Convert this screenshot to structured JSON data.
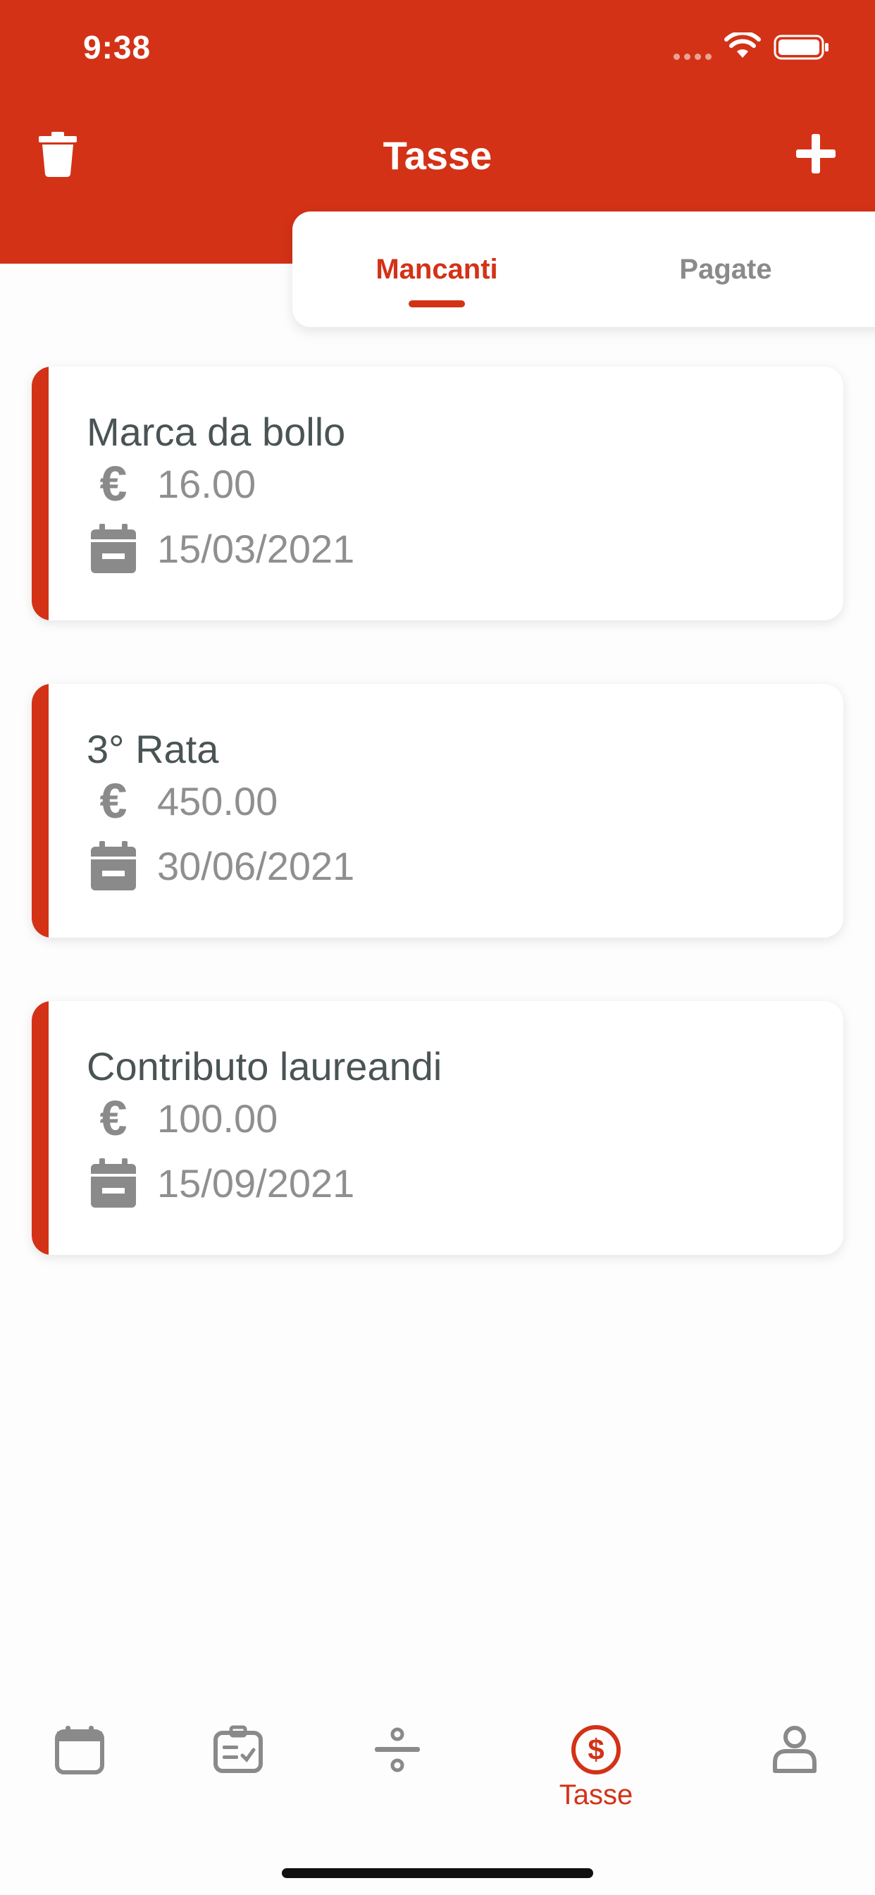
{
  "status": {
    "time": "9:38"
  },
  "nav": {
    "title": "Tasse"
  },
  "tabs": [
    {
      "label": "Mancanti",
      "active": true
    },
    {
      "label": "Pagate",
      "active": false
    }
  ],
  "cards": [
    {
      "title": "Marca da bollo",
      "amount": "16.00",
      "date": "15/03/2021"
    },
    {
      "title": "3° Rata",
      "amount": "450.00",
      "date": "30/06/2021"
    },
    {
      "title": "Contributo laureandi",
      "amount": "100.00",
      "date": "15/09/2021"
    }
  ],
  "bottom_nav": {
    "active_label": "Tasse",
    "items": [
      {
        "icon": "calendar-icon"
      },
      {
        "icon": "id-card-icon"
      },
      {
        "icon": "divide-icon"
      },
      {
        "icon": "dollar-circle-icon",
        "label": "Tasse"
      },
      {
        "icon": "user-icon"
      }
    ]
  },
  "colors": {
    "accent": "#d33217",
    "title_text": "#4a5455",
    "muted_text": "#8f8f8f"
  }
}
